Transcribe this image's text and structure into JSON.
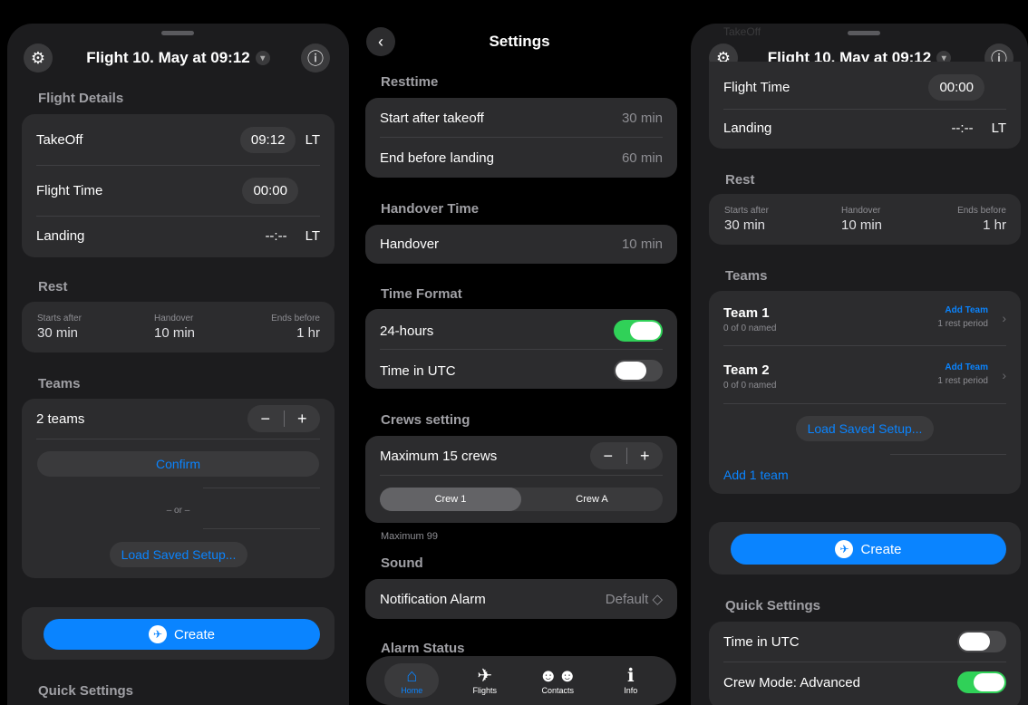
{
  "screen1": {
    "title": "Flight 10. May at 09:12",
    "flight_details_header": "Flight Details",
    "takeoff_label": "TakeOff",
    "takeoff_value": "09:12",
    "lt": "LT",
    "flight_time_label": "Flight Time",
    "flight_time_value": "00:00",
    "landing_label": "Landing",
    "landing_value": "--:--",
    "rest_header": "Rest",
    "rest": {
      "starts_label": "Starts after",
      "starts_value": "30 min",
      "handover_label": "Handover",
      "handover_value": "10 min",
      "ends_label": "Ends before",
      "ends_value": "1 hr"
    },
    "teams_header": "Teams",
    "teams_count": "2 teams",
    "confirm": "Confirm",
    "or": "– or –",
    "load_saved": "Load Saved Setup...",
    "create": "Create",
    "quick_settings": "Quick Settings"
  },
  "screen2": {
    "title": "Settings",
    "resttime_header": "Resttime",
    "start_after_label": "Start after takeoff",
    "start_after_value": "30 min",
    "end_before_label": "End before landing",
    "end_before_value": "60 min",
    "handover_header": "Handover Time",
    "handover_label": "Handover",
    "handover_value": "10 min",
    "time_format_header": "Time Format",
    "hours24_label": "24-hours",
    "hours24_on": true,
    "utc_label": "Time in UTC",
    "utc_on": false,
    "crews_header": "Crews setting",
    "max_crews_label": "Maximum 15 crews",
    "crew_seg": [
      "Crew 1",
      "Crew A"
    ],
    "max99": "Maximum 99",
    "sound_header": "Sound",
    "notif_label": "Notification Alarm",
    "notif_value": "Default ◇",
    "alarm_header": "Alarm Status",
    "tabs": [
      {
        "label": "Home",
        "icon": "home-icon"
      },
      {
        "label": "Flights",
        "icon": "airplane-icon"
      },
      {
        "label": "Contacts",
        "icon": "people-icon"
      },
      {
        "label": "Info",
        "icon": "info-icon"
      }
    ]
  },
  "screen3": {
    "title": "Flight 10. May at 09:12",
    "takeoff_partial": "TakeOff",
    "flight_time_label": "Flight Time",
    "flight_time_value": "00:00",
    "landing_label": "Landing",
    "landing_value": "--:--",
    "lt": "LT",
    "rest_header": "Rest",
    "rest": {
      "starts_label": "Starts after",
      "starts_value": "30 min",
      "handover_label": "Handover",
      "handover_value": "10 min",
      "ends_label": "Ends before",
      "ends_value": "1 hr"
    },
    "teams_header": "Teams",
    "teams": [
      {
        "name": "Team 1",
        "named": "0 of 0 named",
        "add": "Add Team",
        "period": "1 rest period"
      },
      {
        "name": "Team 2",
        "named": "0 of 0 named",
        "add": "Add Team",
        "period": "1 rest period"
      }
    ],
    "load_saved": "Load Saved Setup...",
    "add_team": "Add 1 team",
    "create": "Create",
    "quick_settings": "Quick Settings",
    "utc_label": "Time in UTC",
    "utc_on": false,
    "crew_mode_label": "Crew Mode: Advanced",
    "crew_mode_on": true
  }
}
